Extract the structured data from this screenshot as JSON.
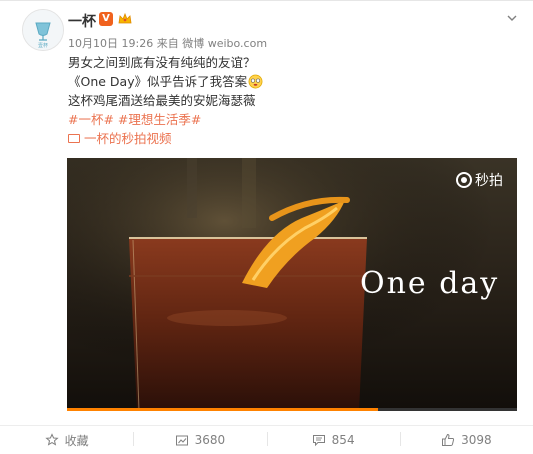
{
  "user": {
    "name": "一杯",
    "verified_badge": "V",
    "avatar_caption": "壹杯"
  },
  "meta": {
    "date": "10月10日 19:26",
    "source_prefix": "来自",
    "source": "微博 weibo.com"
  },
  "content": {
    "line1": "男女之间到底有没有纯纯的友谊？",
    "line2": "《One Day》似乎告诉了我答案",
    "line3": "这杯鸡尾酒送给最美的安妮海瑟薇",
    "tags": "#一杯# #理想生活季#",
    "video_link": "一杯的秒拍视频"
  },
  "video": {
    "overlay_text": "One day",
    "watermark": "秒拍",
    "progress": 0.69
  },
  "actions": {
    "favorite": "收藏",
    "repost": "3680",
    "comment": "854",
    "like": "3098"
  },
  "colors": {
    "link": "#eb7350",
    "badge": "#f0621e",
    "progress": "#ff8200"
  }
}
